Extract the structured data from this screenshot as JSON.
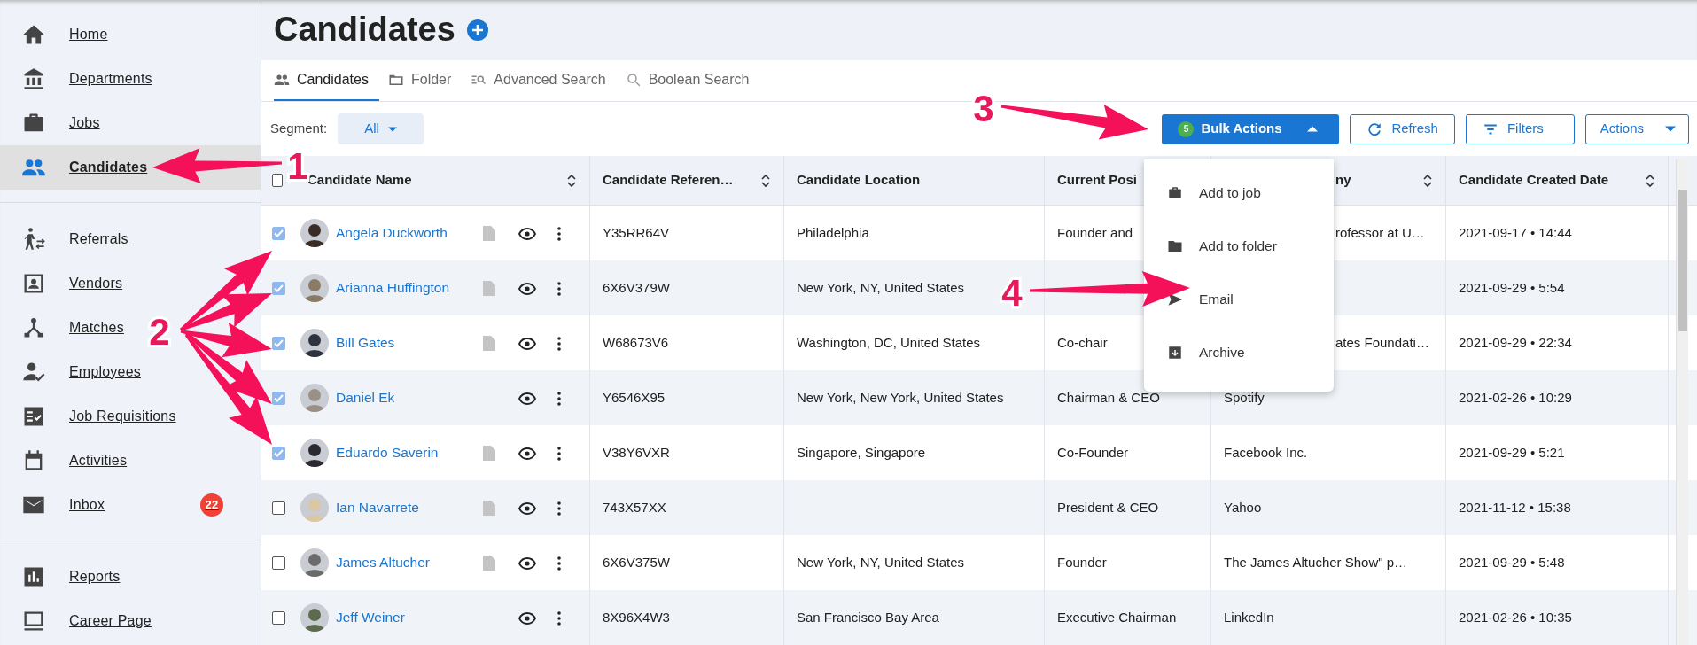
{
  "page_title": "Candidates",
  "sidebar": {
    "groups": [
      {
        "items": [
          {
            "label": "Home",
            "selected": false
          },
          {
            "label": "Departments",
            "selected": false
          },
          {
            "label": "Jobs",
            "selected": false
          },
          {
            "label": "Candidates",
            "selected": true
          }
        ]
      },
      {
        "items": [
          {
            "label": "Referrals",
            "selected": false
          },
          {
            "label": "Vendors",
            "selected": false
          },
          {
            "label": "Matches",
            "selected": false
          },
          {
            "label": "Employees",
            "selected": false
          },
          {
            "label": "Job Requisitions",
            "selected": false
          },
          {
            "label": "Activities",
            "selected": false
          },
          {
            "label": "Inbox",
            "selected": false,
            "badge": "22"
          }
        ]
      },
      {
        "items": [
          {
            "label": "Reports",
            "selected": false
          },
          {
            "label": "Career Page",
            "selected": false
          }
        ]
      }
    ]
  },
  "tabs": [
    {
      "label": "Candidates",
      "selected": true
    },
    {
      "label": "Folder",
      "selected": false
    },
    {
      "label": "Advanced Search",
      "selected": false
    },
    {
      "label": "Boolean Search",
      "selected": false
    }
  ],
  "toolbar": {
    "segment_label": "Segment:",
    "segment_value": "All",
    "bulk_actions": {
      "label": "Bulk Actions",
      "count": "5",
      "expanded": true
    },
    "buttons": [
      "Refresh",
      "Filters"
    ],
    "actions": {
      "label": "Actions"
    }
  },
  "bulk_menu": [
    "Add to job",
    "Add to folder",
    "Email",
    "Archive"
  ],
  "table": {
    "all_checked": false,
    "columns": [
      {
        "label": "Candidate Name",
        "sortable": true
      },
      {
        "label": "Candidate Referen…",
        "sortable": true
      },
      {
        "label": "Candidate Location",
        "sortable": false
      },
      {
        "label": "Current Posi",
        "sortable": false
      },
      {
        "label": "ny",
        "sortable": true,
        "cut": true
      },
      {
        "label": "Candidate Created Date",
        "sortable": true
      }
    ],
    "rows": [
      {
        "name": "Angela Duckworth",
        "checked": true,
        "has_resume": true,
        "reference": "Y35RR64V",
        "location": "Philadelphia",
        "position": "Founder and",
        "company": "rofessor at U…",
        "company_cut": true,
        "created": "2021-09-17 • 14:44"
      },
      {
        "name": "Arianna Huffington",
        "checked": true,
        "has_resume": true,
        "reference": "6X6V379W",
        "location": "New York, NY, United States",
        "created": "2021-09-29 • 5:54"
      },
      {
        "name": "Bill Gates",
        "checked": true,
        "has_resume": true,
        "reference": "W68673V6",
        "location": "Washington, DC, United States",
        "position": "Co-chair",
        "company": "ates Foundati…",
        "company_cut": true,
        "created": "2021-09-29 • 22:34"
      },
      {
        "name": "Daniel Ek",
        "checked": true,
        "has_resume": false,
        "reference": "Y6546X95",
        "location": "New York, New York, United States",
        "position": "Chairman & CEO",
        "company": "Spotify",
        "created": "2021-02-26 • 10:29"
      },
      {
        "name": "Eduardo Saverin",
        "checked": true,
        "has_resume": true,
        "reference": "V38Y6VXR",
        "location": "Singapore, Singapore",
        "position": "Co-Founder",
        "company": "Facebook Inc.",
        "created": "2021-09-29 • 5:21"
      },
      {
        "name": "Ian Navarrete",
        "checked": false,
        "has_resume": true,
        "reference": "743X57XX",
        "position": "President & CEO",
        "company": "Yahoo",
        "created": "2021-11-12 • 15:38"
      },
      {
        "name": "James Altucher",
        "checked": false,
        "has_resume": true,
        "reference": "6X6V375W",
        "location": "New York, NY, United States",
        "position": "Founder",
        "company": "The James Altucher Show\" p…",
        "created": "2021-09-29 • 5:48"
      },
      {
        "name": "Jeff Weiner",
        "checked": false,
        "has_resume": false,
        "reference": "8X96X4W3",
        "location": "San Francisco Bay Area",
        "position": "Executive Chairman",
        "company": "LinkedIn",
        "created": "2021-02-26 • 10:35"
      }
    ]
  },
  "annotations": [
    {
      "label": "1"
    },
    {
      "label": "2"
    },
    {
      "label": "3"
    },
    {
      "label": "4"
    }
  ]
}
